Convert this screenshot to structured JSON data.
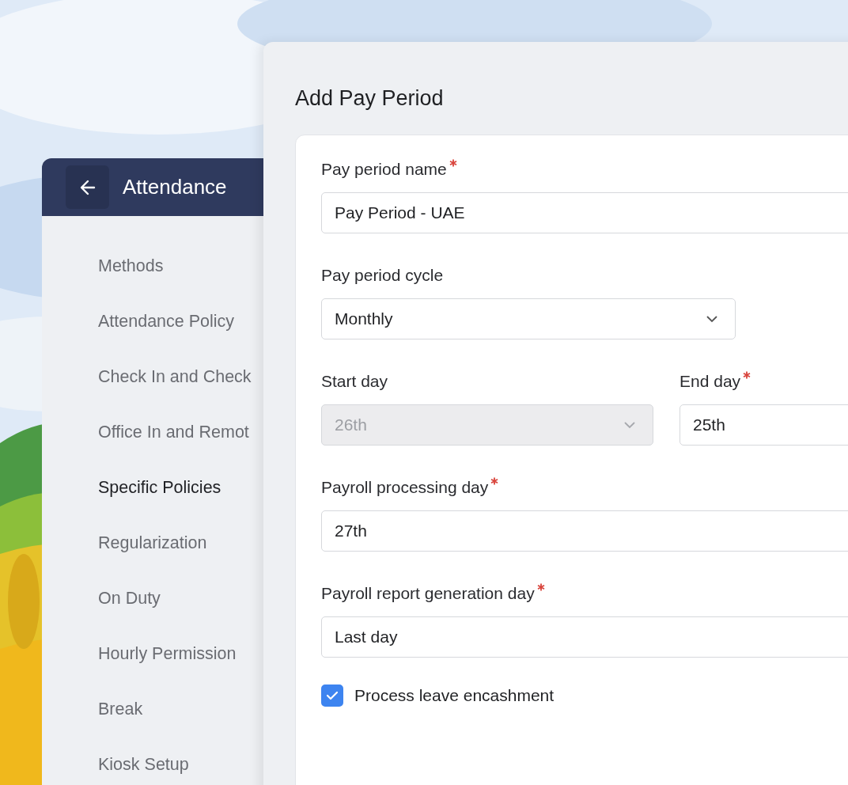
{
  "sidebar": {
    "title": "Attendance",
    "items": [
      {
        "label": "Methods",
        "selected": false
      },
      {
        "label": "Attendance Policy",
        "selected": false
      },
      {
        "label": "Check In and Check",
        "selected": false
      },
      {
        "label": "Office In and Remot",
        "selected": false
      },
      {
        "label": "Specific Policies",
        "selected": true
      },
      {
        "label": "Regularization",
        "selected": false
      },
      {
        "label": "On Duty",
        "selected": false
      },
      {
        "label": "Hourly Permission",
        "selected": false
      },
      {
        "label": "Break",
        "selected": false
      },
      {
        "label": "Kiosk Setup",
        "selected": false
      }
    ]
  },
  "dialog": {
    "title": "Add Pay Period",
    "rows": [
      {
        "fields": [
          {
            "kind": "text",
            "label": "Pay period name",
            "required": true,
            "value": "Pay Period - UAE",
            "disabled": false
          }
        ]
      },
      {
        "fields": [
          {
            "kind": "select",
            "label": "Pay period cycle",
            "required": false,
            "value": "Monthly",
            "disabled": false
          }
        ]
      },
      {
        "fields": [
          {
            "kind": "select",
            "label": "Start day",
            "required": false,
            "value": "26th",
            "disabled": true
          },
          {
            "kind": "text",
            "label": "End day",
            "required": true,
            "value": "25th",
            "disabled": false
          }
        ]
      },
      {
        "fields": [
          {
            "kind": "text",
            "label": "Payroll processing day",
            "required": true,
            "value": "27th",
            "disabled": false
          }
        ]
      },
      {
        "fields": [
          {
            "kind": "text",
            "label": "Payroll report generation day",
            "required": true,
            "value": "Last day",
            "disabled": false
          }
        ]
      }
    ],
    "checkbox": {
      "label": "Process leave encashment",
      "checked": true
    }
  }
}
